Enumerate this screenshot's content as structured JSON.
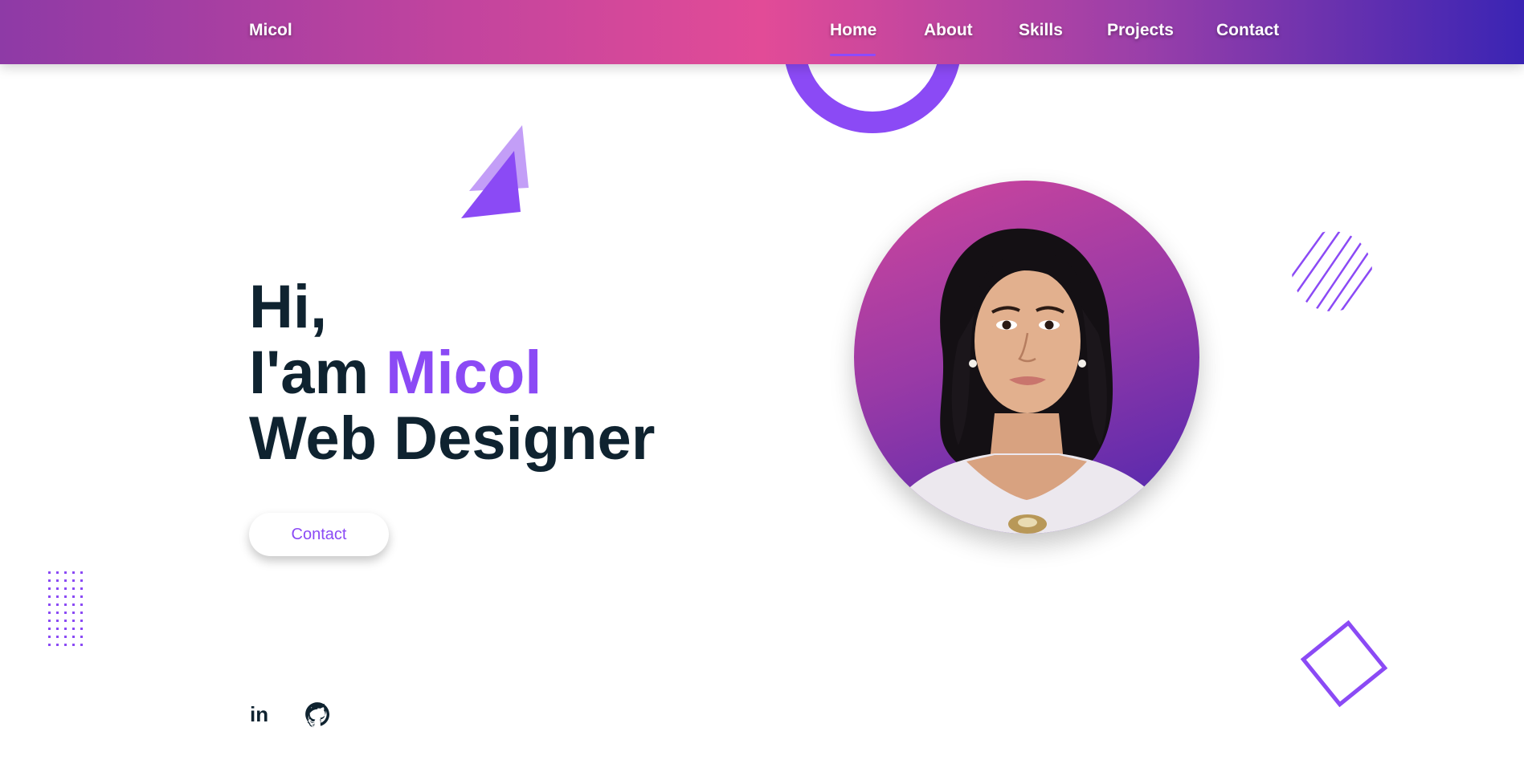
{
  "header": {
    "brand": "Micol",
    "nav": [
      {
        "label": "Home",
        "active": true
      },
      {
        "label": "About",
        "active": false
      },
      {
        "label": "Skills",
        "active": false
      },
      {
        "label": "Projects",
        "active": false
      },
      {
        "label": "Contact",
        "active": false
      }
    ]
  },
  "hero": {
    "greeting": "Hi,",
    "intro": "I'am ",
    "name": "Micol",
    "role": "Web Designer",
    "contact_button": "Contact"
  },
  "social": [
    {
      "name": "linkedin",
      "icon": "linkedin-icon",
      "glyph": "in"
    },
    {
      "name": "github",
      "icon": "github-icon"
    }
  ],
  "colors": {
    "accent": "#8b4af5",
    "text_dark": "#0f2330",
    "header_gradient": [
      "#8e3aa6",
      "#e24b97",
      "#3a24b4"
    ]
  }
}
